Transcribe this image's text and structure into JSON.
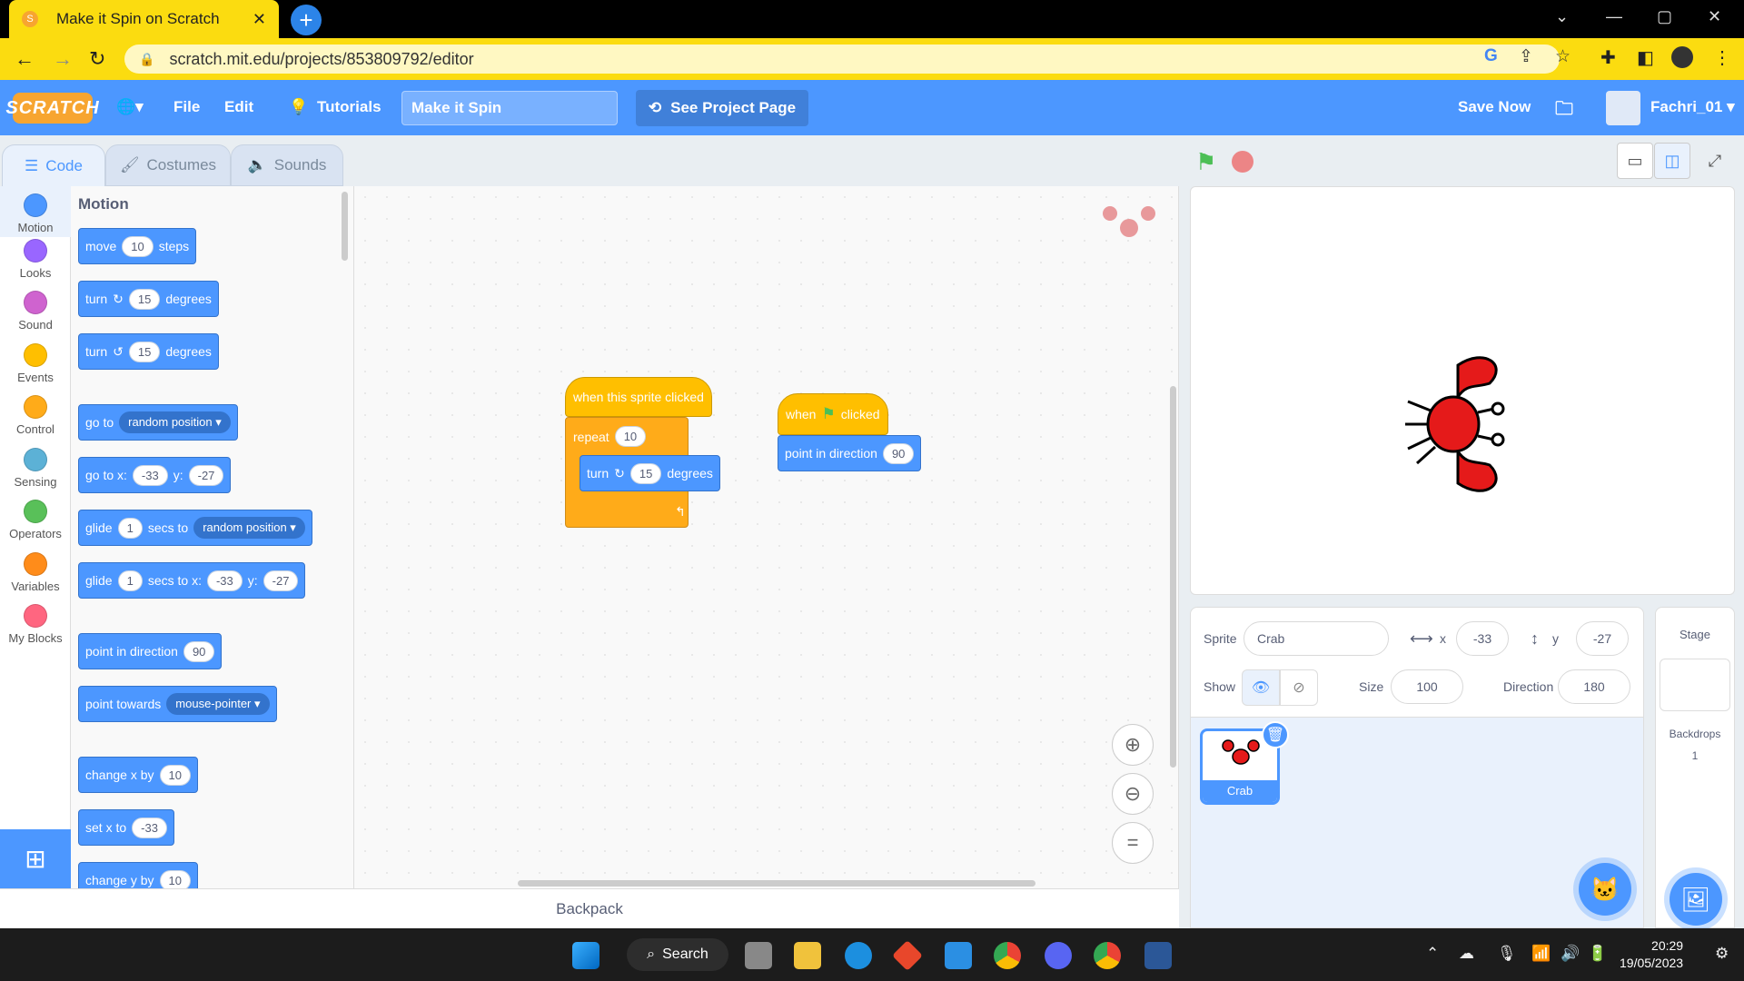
{
  "browser": {
    "tab_title": "Make it Spin on Scratch",
    "close": "✕",
    "new_tab": "+",
    "url": "scratch.mit.edu/projects/853809792/editor",
    "min": "—",
    "max": "▢",
    "close_win": "✕",
    "chevron": "⌄"
  },
  "menubar": {
    "logo": "SCRATCH",
    "language": "🌐▾",
    "file": "File",
    "edit": "Edit",
    "tutorials": "Tutorials",
    "project_title": "Make it Spin",
    "see_project_page": "See Project Page",
    "save_now": "Save Now",
    "username": "Fachri_01 ▾"
  },
  "editor_tabs": {
    "code": "Code",
    "costumes": "Costumes",
    "sounds": "Sounds"
  },
  "categories": [
    {
      "label": "Motion",
      "color": "#4c97ff"
    },
    {
      "label": "Looks",
      "color": "#9966ff"
    },
    {
      "label": "Sound",
      "color": "#cf63cf"
    },
    {
      "label": "Events",
      "color": "#ffbf00"
    },
    {
      "label": "Control",
      "color": "#ffab19"
    },
    {
      "label": "Sensing",
      "color": "#5cb1d6"
    },
    {
      "label": "Operators",
      "color": "#59c059"
    },
    {
      "label": "Variables",
      "color": "#ff8c1a"
    },
    {
      "label": "My Blocks",
      "color": "#ff6680"
    }
  ],
  "flyout": {
    "heading": "Motion",
    "move": {
      "a": "move",
      "v": "10",
      "b": "steps"
    },
    "turn_r": {
      "a": "turn",
      "icon": "↻",
      "v": "15",
      "b": "degrees"
    },
    "turn_l": {
      "a": "turn",
      "icon": "↺",
      "v": "15",
      "b": "degrees"
    },
    "goto": {
      "a": "go to",
      "dd": "random position ▾"
    },
    "gotoxy": {
      "a": "go to x:",
      "x": "-33",
      "b": "y:",
      "y": "-27"
    },
    "glide": {
      "a": "glide",
      "v": "1",
      "b": "secs to",
      "dd": "random position ▾"
    },
    "glidexy": {
      "a": "glide",
      "v": "1",
      "b": "secs to x:",
      "x": "-33",
      "c": "y:",
      "y": "-27"
    },
    "point_dir": {
      "a": "point in direction",
      "v": "90"
    },
    "point_tw": {
      "a": "point towards",
      "dd": "mouse-pointer ▾"
    },
    "change_x": {
      "a": "change x by",
      "v": "10"
    },
    "set_x": {
      "a": "set x to",
      "v": "-33"
    },
    "change_y": {
      "a": "change y by",
      "v": "10"
    }
  },
  "script": {
    "hat1": "when this sprite clicked",
    "repeat": {
      "a": "repeat",
      "v": "10"
    },
    "inner_turn": {
      "a": "turn",
      "icon": "↻",
      "v": "15",
      "b": "degrees"
    },
    "hat2": {
      "a": "when",
      "flag": "⚑",
      "b": "clicked"
    },
    "point": {
      "a": "point in direction",
      "v": "90"
    },
    "zoom_in": "⊕",
    "zoom_out": "⊖",
    "zoom_reset": "="
  },
  "backpack": "Backpack",
  "sprite_info": {
    "sprite_label": "Sprite",
    "sprite_name": "Crab",
    "x_label": "x",
    "x": "-33",
    "y_label": "y",
    "y": "-27",
    "show_label": "Show",
    "size_label": "Size",
    "size": "100",
    "direction_label": "Direction",
    "direction": "180"
  },
  "sprites": [
    {
      "name": "Crab"
    }
  ],
  "stage_pane": {
    "label": "Stage",
    "backdrops_label": "Backdrops",
    "backdrops": "1"
  },
  "taskbar": {
    "search": "Search",
    "time": "20:29",
    "date": "19/05/2023"
  }
}
